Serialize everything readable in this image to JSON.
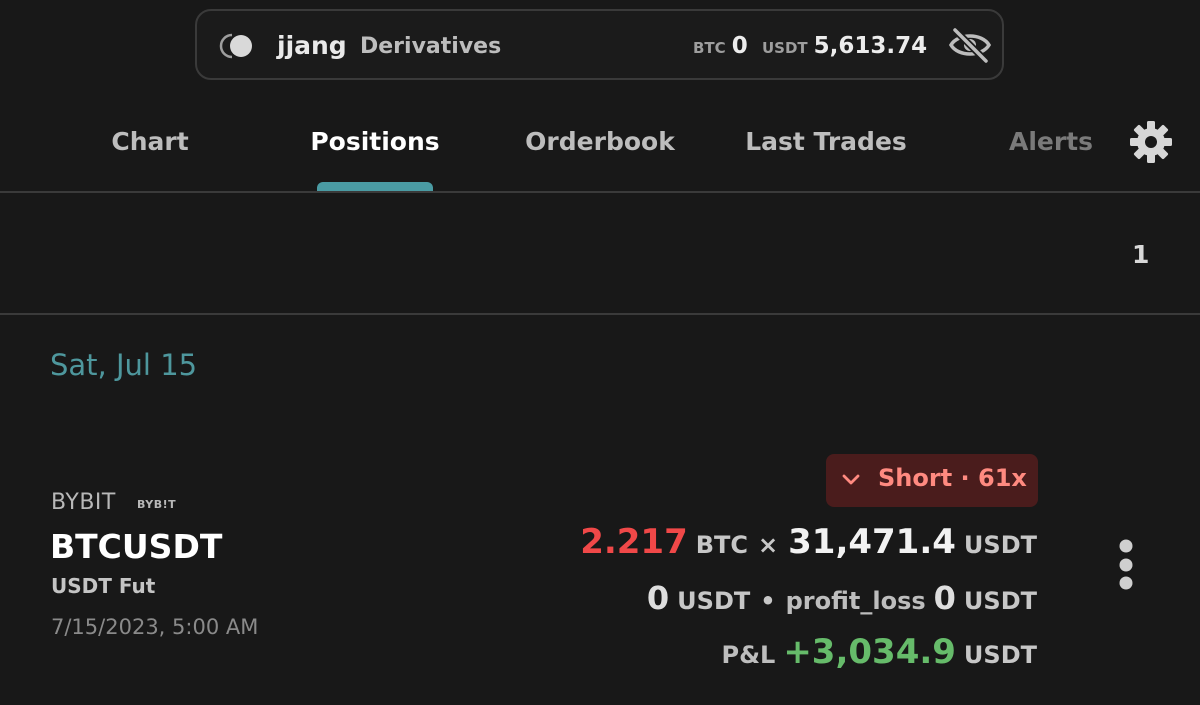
{
  "account": {
    "username": "jjang",
    "account_type": "Derivatives",
    "balances": [
      {
        "currency": "BTC",
        "value": "0"
      },
      {
        "currency": "USDT",
        "value": "5,613.74"
      }
    ],
    "icons": {
      "toggle": "toggle-icon",
      "visibility": "eye-off-icon"
    }
  },
  "tabs": [
    {
      "label": "Chart"
    },
    {
      "label": "Positions",
      "active": true
    },
    {
      "label": "Orderbook"
    },
    {
      "label": "Last Trades"
    },
    {
      "label": "Alerts"
    }
  ],
  "settings_icon": "gear-icon",
  "positions_count": "1",
  "date_header": "Sat, Jul 15",
  "position": {
    "exchange": "BYBIT",
    "exchange_logo": "BYB!T",
    "symbol": "BTCUSDT",
    "market_type": "USDT Fut",
    "timestamp": "7/15/2023, 5:00 AM",
    "side_badge": "Short · 61x",
    "side_icon": "chevron-down-icon",
    "quantity": "2.217",
    "quantity_unit": "BTC",
    "times": "×",
    "price": "31,471.4",
    "price_unit": "USDT",
    "value": "0",
    "value_unit": "USDT",
    "separator": "•",
    "profit_loss_label": "profit_loss",
    "profit_loss_value": "0",
    "profit_loss_unit": "USDT",
    "pnl_label": "P&L",
    "pnl_value": "+3,034.9",
    "pnl_unit": "USDT",
    "more_icon": "more-vertical-icon"
  },
  "colors": {
    "background": "#181818",
    "accent": "#4a9ba3",
    "short_red": "#f04848",
    "badge_bg": "#4a1c1c",
    "profit_green": "#66bb6a"
  }
}
